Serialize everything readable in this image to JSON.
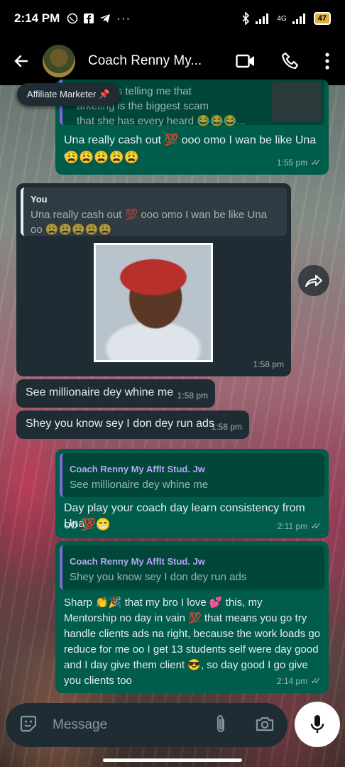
{
  "status_bar": {
    "time": "2:14 PM",
    "network": "4G",
    "battery": "47"
  },
  "header": {
    "contact_name": "Coach Renny My..."
  },
  "tooltip": {
    "text": "Affiliate Marketer 📌"
  },
  "messages": [
    {
      "id": "m1",
      "direction": "out",
      "quote_text": "...eone was telling me that ...arketing is the biggest scam that she has every heard 😂😂😂...",
      "quote_lines": [
        "eone was telling me that",
        "arketing is the biggest scam",
        "that she has every heard 😂😂😂..."
      ],
      "text": "Una really cash out 💯 ooo omo I wan be like Una oo 😩😩😩😩😩",
      "line1": "Una really cash out 💯 ooo omo I wan be like Una oo",
      "line2": "😩😩😩😩😩",
      "time": "1:55 pm"
    },
    {
      "id": "m2",
      "direction": "in",
      "quote_author": "You",
      "quote_line1": "Una really cash out 💯 ooo omo I wan be like Una",
      "quote_line2": "oo 😩😩😩😩😩",
      "has_image": true,
      "time": "1:58 pm"
    },
    {
      "id": "m3",
      "direction": "in",
      "text": "See millionaire dey whine me",
      "time": "1:58 pm"
    },
    {
      "id": "m4",
      "direction": "in",
      "text": "Shey you know sey I don dey run ads",
      "time": "1:58 pm"
    },
    {
      "id": "m5",
      "direction": "out",
      "quote_author": "Coach Renny My Afflt Stud. Jw",
      "quote_text": "See millionaire dey whine me",
      "line1": "Day play your coach day learn consistency from Una",
      "line2": "oo 💯😁",
      "time": "2:11 pm"
    },
    {
      "id": "m6",
      "direction": "out",
      "quote_author": "Coach Renny My Afflt Stud. Jw",
      "quote_text": "Shey you know sey I don dey run ads",
      "lines": [
        "Sharp 👏🎉 that my bro I love 💕 this, my",
        "Mentorship no day in vain 💯 that means you go try",
        "handle clients ads na right, because the work loads go",
        "reduce for me oo I get 13 students self were day good",
        "and I day give them client 😎, so day good I go give",
        "you clients too"
      ],
      "time": "2:14 pm"
    }
  ],
  "composer": {
    "placeholder": "Message"
  }
}
